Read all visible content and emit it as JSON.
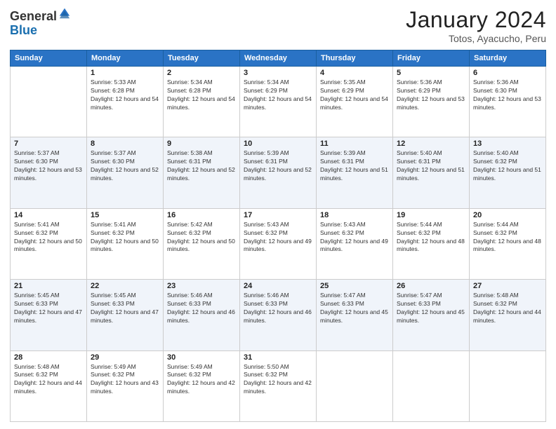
{
  "logo": {
    "general": "General",
    "blue": "Blue"
  },
  "header": {
    "title": "January 2024",
    "subtitle": "Totos, Ayacucho, Peru"
  },
  "weekdays": [
    "Sunday",
    "Monday",
    "Tuesday",
    "Wednesday",
    "Thursday",
    "Friday",
    "Saturday"
  ],
  "weeks": [
    [
      {
        "day": "",
        "empty": true
      },
      {
        "day": "1",
        "sunrise": "Sunrise: 5:33 AM",
        "sunset": "Sunset: 6:28 PM",
        "daylight": "Daylight: 12 hours and 54 minutes."
      },
      {
        "day": "2",
        "sunrise": "Sunrise: 5:34 AM",
        "sunset": "Sunset: 6:28 PM",
        "daylight": "Daylight: 12 hours and 54 minutes."
      },
      {
        "day": "3",
        "sunrise": "Sunrise: 5:34 AM",
        "sunset": "Sunset: 6:29 PM",
        "daylight": "Daylight: 12 hours and 54 minutes."
      },
      {
        "day": "4",
        "sunrise": "Sunrise: 5:35 AM",
        "sunset": "Sunset: 6:29 PM",
        "daylight": "Daylight: 12 hours and 54 minutes."
      },
      {
        "day": "5",
        "sunrise": "Sunrise: 5:36 AM",
        "sunset": "Sunset: 6:29 PM",
        "daylight": "Daylight: 12 hours and 53 minutes."
      },
      {
        "day": "6",
        "sunrise": "Sunrise: 5:36 AM",
        "sunset": "Sunset: 6:30 PM",
        "daylight": "Daylight: 12 hours and 53 minutes."
      }
    ],
    [
      {
        "day": "7",
        "sunrise": "Sunrise: 5:37 AM",
        "sunset": "Sunset: 6:30 PM",
        "daylight": "Daylight: 12 hours and 53 minutes."
      },
      {
        "day": "8",
        "sunrise": "Sunrise: 5:37 AM",
        "sunset": "Sunset: 6:30 PM",
        "daylight": "Daylight: 12 hours and 52 minutes."
      },
      {
        "day": "9",
        "sunrise": "Sunrise: 5:38 AM",
        "sunset": "Sunset: 6:31 PM",
        "daylight": "Daylight: 12 hours and 52 minutes."
      },
      {
        "day": "10",
        "sunrise": "Sunrise: 5:39 AM",
        "sunset": "Sunset: 6:31 PM",
        "daylight": "Daylight: 12 hours and 52 minutes."
      },
      {
        "day": "11",
        "sunrise": "Sunrise: 5:39 AM",
        "sunset": "Sunset: 6:31 PM",
        "daylight": "Daylight: 12 hours and 51 minutes."
      },
      {
        "day": "12",
        "sunrise": "Sunrise: 5:40 AM",
        "sunset": "Sunset: 6:31 PM",
        "daylight": "Daylight: 12 hours and 51 minutes."
      },
      {
        "day": "13",
        "sunrise": "Sunrise: 5:40 AM",
        "sunset": "Sunset: 6:32 PM",
        "daylight": "Daylight: 12 hours and 51 minutes."
      }
    ],
    [
      {
        "day": "14",
        "sunrise": "Sunrise: 5:41 AM",
        "sunset": "Sunset: 6:32 PM",
        "daylight": "Daylight: 12 hours and 50 minutes."
      },
      {
        "day": "15",
        "sunrise": "Sunrise: 5:41 AM",
        "sunset": "Sunset: 6:32 PM",
        "daylight": "Daylight: 12 hours and 50 minutes."
      },
      {
        "day": "16",
        "sunrise": "Sunrise: 5:42 AM",
        "sunset": "Sunset: 6:32 PM",
        "daylight": "Daylight: 12 hours and 50 minutes."
      },
      {
        "day": "17",
        "sunrise": "Sunrise: 5:43 AM",
        "sunset": "Sunset: 6:32 PM",
        "daylight": "Daylight: 12 hours and 49 minutes."
      },
      {
        "day": "18",
        "sunrise": "Sunrise: 5:43 AM",
        "sunset": "Sunset: 6:32 PM",
        "daylight": "Daylight: 12 hours and 49 minutes."
      },
      {
        "day": "19",
        "sunrise": "Sunrise: 5:44 AM",
        "sunset": "Sunset: 6:32 PM",
        "daylight": "Daylight: 12 hours and 48 minutes."
      },
      {
        "day": "20",
        "sunrise": "Sunrise: 5:44 AM",
        "sunset": "Sunset: 6:32 PM",
        "daylight": "Daylight: 12 hours and 48 minutes."
      }
    ],
    [
      {
        "day": "21",
        "sunrise": "Sunrise: 5:45 AM",
        "sunset": "Sunset: 6:33 PM",
        "daylight": "Daylight: 12 hours and 47 minutes."
      },
      {
        "day": "22",
        "sunrise": "Sunrise: 5:45 AM",
        "sunset": "Sunset: 6:33 PM",
        "daylight": "Daylight: 12 hours and 47 minutes."
      },
      {
        "day": "23",
        "sunrise": "Sunrise: 5:46 AM",
        "sunset": "Sunset: 6:33 PM",
        "daylight": "Daylight: 12 hours and 46 minutes."
      },
      {
        "day": "24",
        "sunrise": "Sunrise: 5:46 AM",
        "sunset": "Sunset: 6:33 PM",
        "daylight": "Daylight: 12 hours and 46 minutes."
      },
      {
        "day": "25",
        "sunrise": "Sunrise: 5:47 AM",
        "sunset": "Sunset: 6:33 PM",
        "daylight": "Daylight: 12 hours and 45 minutes."
      },
      {
        "day": "26",
        "sunrise": "Sunrise: 5:47 AM",
        "sunset": "Sunset: 6:33 PM",
        "daylight": "Daylight: 12 hours and 45 minutes."
      },
      {
        "day": "27",
        "sunrise": "Sunrise: 5:48 AM",
        "sunset": "Sunset: 6:32 PM",
        "daylight": "Daylight: 12 hours and 44 minutes."
      }
    ],
    [
      {
        "day": "28",
        "sunrise": "Sunrise: 5:48 AM",
        "sunset": "Sunset: 6:32 PM",
        "daylight": "Daylight: 12 hours and 44 minutes."
      },
      {
        "day": "29",
        "sunrise": "Sunrise: 5:49 AM",
        "sunset": "Sunset: 6:32 PM",
        "daylight": "Daylight: 12 hours and 43 minutes."
      },
      {
        "day": "30",
        "sunrise": "Sunrise: 5:49 AM",
        "sunset": "Sunset: 6:32 PM",
        "daylight": "Daylight: 12 hours and 42 minutes."
      },
      {
        "day": "31",
        "sunrise": "Sunrise: 5:50 AM",
        "sunset": "Sunset: 6:32 PM",
        "daylight": "Daylight: 12 hours and 42 minutes."
      },
      {
        "day": "",
        "empty": true
      },
      {
        "day": "",
        "empty": true
      },
      {
        "day": "",
        "empty": true
      }
    ]
  ]
}
